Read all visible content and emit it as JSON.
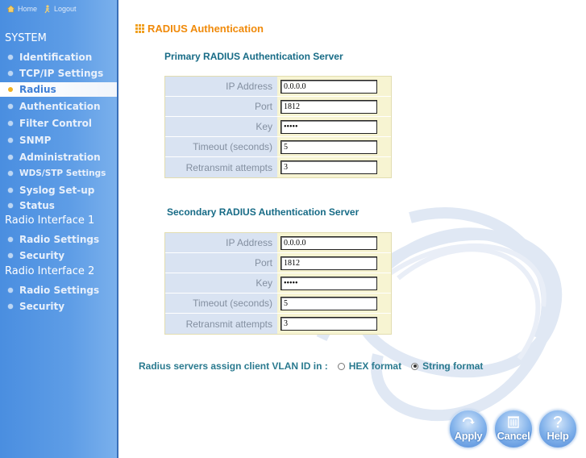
{
  "topbar": {
    "home_label": "Home",
    "logout_label": "Logout"
  },
  "sidebar": {
    "system_label": "SYSTEM",
    "system_items": [
      {
        "label": "Identification"
      },
      {
        "label": "TCP/IP Settings"
      },
      {
        "label": "Radius"
      },
      {
        "label": "Authentication"
      },
      {
        "label": "Filter Control"
      },
      {
        "label": "SNMP"
      },
      {
        "label": "Administration"
      },
      {
        "label": "WDS/STP Settings"
      },
      {
        "label": "Syslog Set-up"
      },
      {
        "label": "Status"
      }
    ],
    "radio1_label": "Radio Interface 1",
    "radio1_items": [
      {
        "label": "Radio Settings"
      },
      {
        "label": "Security"
      }
    ],
    "radio2_label": "Radio Interface 2",
    "radio2_items": [
      {
        "label": "Radio Settings"
      },
      {
        "label": "Security"
      }
    ]
  },
  "main": {
    "title": "RADIUS Authentication",
    "primary": {
      "heading": "Primary RADIUS Authentication Server",
      "ip_label": "IP Address",
      "ip_value": "0.0.0.0",
      "port_label": "Port",
      "port_value": "1812",
      "key_label": "Key",
      "key_value": "*****",
      "timeout_label": "Timeout (seconds)",
      "timeout_value": "5",
      "retransmit_label": "Retransmit attempts",
      "retransmit_value": "3"
    },
    "secondary": {
      "heading": "Secondary RADIUS Authentication Server",
      "ip_label": "IP Address",
      "ip_value": "0.0.0.0",
      "port_label": "Port",
      "port_value": "1812",
      "key_label": "Key",
      "key_value": "*****",
      "timeout_label": "Timeout (seconds)",
      "timeout_value": "5",
      "retransmit_label": "Retransmit attempts",
      "retransmit_value": "3"
    },
    "vlan": {
      "label": "Radius servers assign client VLAN ID in :",
      "hex_label": "HEX format",
      "string_label": "String format",
      "selected": "String format"
    }
  },
  "buttons": {
    "apply": "Apply",
    "cancel": "Cancel",
    "help": "Help"
  },
  "colors": {
    "title": "#f08a0a",
    "subhead": "#176b86",
    "sidebar": "#5e9de6",
    "highlight": "#f0b11f"
  }
}
